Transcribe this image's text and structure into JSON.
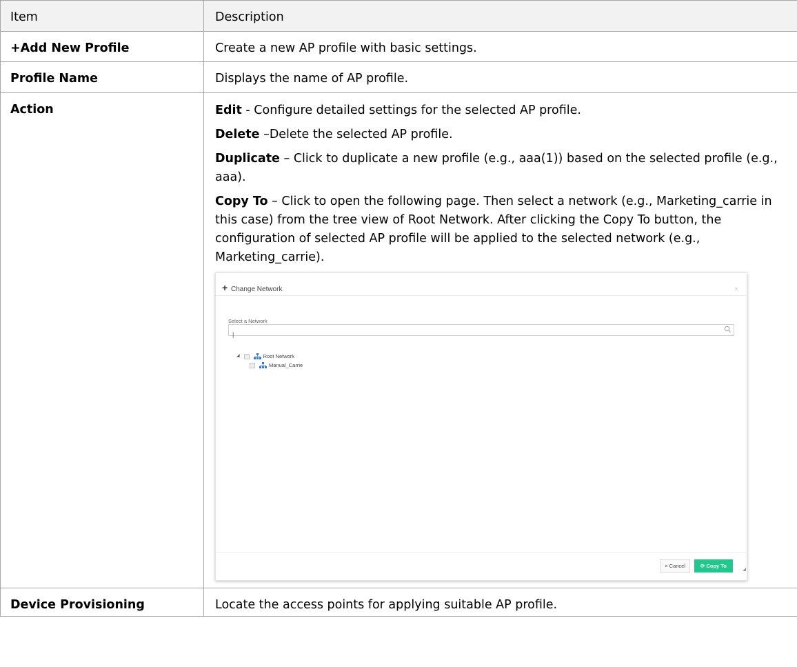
{
  "table": {
    "header": {
      "item": "Item",
      "description": "Description"
    },
    "rows": [
      {
        "item": "+Add New Profile",
        "description": "Create a new AP profile with basic settings."
      },
      {
        "item": "Profile Name",
        "description": "Displays the name of AP profile."
      },
      {
        "item": "Action",
        "paras": [
          {
            "term": "Edit",
            "text": " - Configure detailed settings for the selected AP profile."
          },
          {
            "term": "Delete",
            "text": " –Delete the selected AP profile."
          },
          {
            "term": "Duplicate",
            "text": " – Click to duplicate a new profile (e.g., aaa(1)) based on the selected profile (e.g., aaa)."
          },
          {
            "term": "Copy To",
            "text": " – Click to open the following page. Then select a network (e.g., Marketing_carrie in this case) from the tree view of Root Network. After clicking the Copy To button, the configuration of selected AP profile will be applied to the selected network (e.g., Marketing_carrie)."
          }
        ]
      },
      {
        "item": "Device Provisioning",
        "description": "Locate the access points for applying suitable AP profile."
      }
    ]
  },
  "dialog": {
    "title": "Change Network",
    "close": "×",
    "label": "Select a Network",
    "search_value": "|",
    "tree": [
      {
        "label": "Root Network",
        "level": 0,
        "expanded": true
      },
      {
        "label": "Manual_Carrie",
        "level": 1
      }
    ],
    "cancel": "× Cancel",
    "copy_to": "Copy To",
    "colors": {
      "copy_button": "#22c78e",
      "network_icon": "#2e7bd6"
    }
  }
}
